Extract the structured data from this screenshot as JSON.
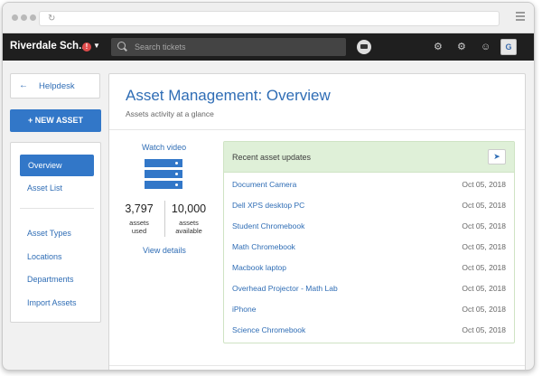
{
  "header": {
    "brand": "Riverdale Sch...",
    "alert_count": "!",
    "search_placeholder": "Search tickets",
    "avatar_initial": "G"
  },
  "sidebar": {
    "back_label": "Helpdesk",
    "new_asset_label": "NEW ASSET",
    "items": [
      {
        "label": "Overview",
        "active": true
      },
      {
        "label": "Asset List"
      },
      {
        "label": "Asset Types"
      },
      {
        "label": "Locations"
      },
      {
        "label": "Departments"
      },
      {
        "label": "Import Assets"
      }
    ]
  },
  "main": {
    "title": "Asset Management: Overview",
    "subtitle": "Assets activity at a glance",
    "watch_video": "Watch video",
    "stats": [
      {
        "value": "3,797",
        "label_line1": "assets",
        "label_line2": "used"
      },
      {
        "value": "10,000",
        "label_line1": "assets",
        "label_line2": "available"
      }
    ],
    "view_details": "View details",
    "updates": {
      "title": "Recent asset updates",
      "rows": [
        {
          "name": "Document Camera",
          "date": "Oct 05, 2018"
        },
        {
          "name": "Dell XPS desktop PC",
          "date": "Oct 05, 2018"
        },
        {
          "name": "Student Chromebook",
          "date": "Oct 05, 2018"
        },
        {
          "name": "Math Chromebook",
          "date": "Oct 05, 2018"
        },
        {
          "name": "Macbook laptop",
          "date": "Oct 05, 2018"
        },
        {
          "name": "Overhead Projector - Math Lab",
          "date": "Oct 05, 2018"
        },
        {
          "name": "iPhone",
          "date": "Oct 05, 2018"
        },
        {
          "name": "Science Chromebook",
          "date": "Oct 05, 2018"
        }
      ]
    }
  },
  "colors": {
    "accent": "#3277c8",
    "nav_bg": "#1f1f1f",
    "update_head": "#dff0d8"
  }
}
